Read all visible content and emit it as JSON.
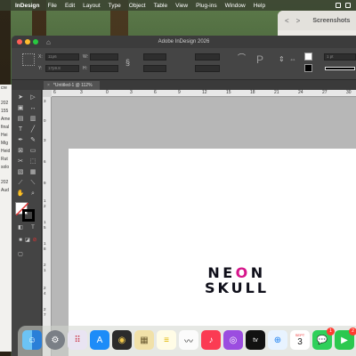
{
  "menubar": {
    "app_name": "InDesign",
    "items": [
      "File",
      "Edit",
      "Layout",
      "Type",
      "Object",
      "Table",
      "View",
      "Plug-ins",
      "Window",
      "Help"
    ]
  },
  "finder": {
    "title": "Screenshots",
    "back": "<",
    "forward": ">"
  },
  "left_window": {
    "lines": [
      "cre",
      "202",
      "155",
      "Ame",
      "final",
      "Hei",
      "Mig",
      "Heid",
      "Rut",
      "solo",
      "202",
      "Aud"
    ]
  },
  "window": {
    "title": "Adobe InDesign 2026"
  },
  "control_panel": {
    "x_label": "X:",
    "x_value": "11p6",
    "y_label": "Y:",
    "y_value": "17p9.8",
    "w_label": "W:",
    "h_label": "H:",
    "stroke_weight": "1 pt"
  },
  "document": {
    "tab_title": "*Untitled-1 @ 112%",
    "close": "×"
  },
  "ruler": {
    "h_labels": [
      "6",
      "3",
      "0",
      "3",
      "6",
      "9",
      "12",
      "15",
      "18",
      "21",
      "24",
      "27",
      "30"
    ],
    "v_labels": [
      "3",
      "0",
      "3",
      "6",
      "9",
      "1",
      "2",
      "1",
      "5",
      "1",
      "8",
      "2",
      "1",
      "2",
      "4",
      "2",
      "7"
    ]
  },
  "logo": {
    "line1_pre": "NE",
    "line1_o": "O",
    "line1_post": "N",
    "line2": "SKULL",
    "accent_color": "#d6168b"
  },
  "dock": {
    "apps": [
      "finder-icon",
      "launchpad-icon",
      "apps-grid-icon",
      "app-store-icon",
      "photo-booth-icon",
      "notes-icon",
      "freeform-icon",
      "music-icon",
      "podcasts-icon",
      "apple-tv-icon",
      "safari-icon",
      "calendar-icon",
      "messages-icon",
      "facetime-icon"
    ],
    "calendar_month": "SEPT",
    "calendar_day": "3",
    "messages_badge": "1",
    "facetime_badge": "2"
  }
}
